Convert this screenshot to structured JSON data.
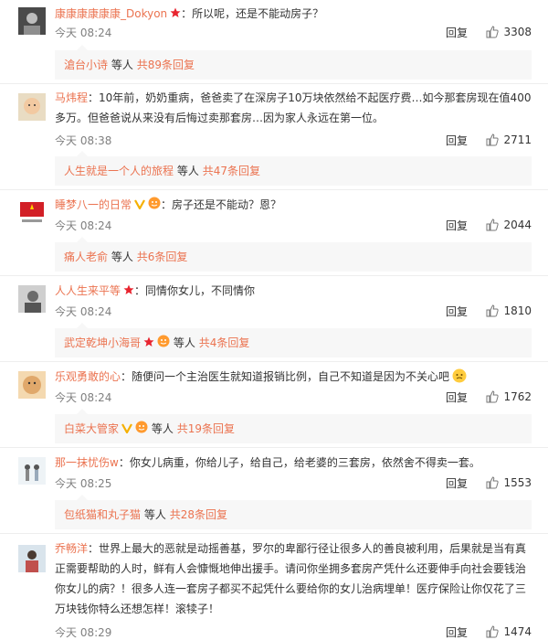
{
  "colors": {
    "accent": "#eb7350",
    "meta": "#808080",
    "sub_bg": "#f7f7f7",
    "crown": "#e8242f",
    "vip": "#f5b000"
  },
  "common": {
    "reply_label": "回复",
    "like_icon": "thumbs-up-icon",
    "etc": "等人",
    "total_prefix": "共",
    "total_suffix": "条回复"
  },
  "comments": [
    {
      "user": "康康康康康康_Dokyon",
      "text": "：所以呢，还是不能动房子？",
      "time": "今天 08:24",
      "likes": "3308",
      "sub_user": "滄台小诗",
      "sub_count": "89"
    },
    {
      "user": "马炜程",
      "text": "：10年前，奶奶重病，爸爸卖了在深房子10万块依然给不起医疗费…如今那套房现在值400多万。但爸爸说从来没有后悔过卖那套房…因为家人永远在第一位。",
      "time": "今天 08:38",
      "likes": "2711",
      "sub_user": "人生就是一个人的旅程",
      "sub_count": "47"
    },
    {
      "user": "睡梦八一的日常",
      "text": "：房子还是不能动？恩？",
      "time": "今天 08:24",
      "likes": "2044",
      "sub_user": "痛人老俞",
      "sub_count": "6"
    },
    {
      "user": "人人生来平等",
      "text": "：同情你女儿，不同情你",
      "time": "今天 08:24",
      "likes": "1810",
      "sub_user": "武定乾坤小海哥",
      "sub_count": "4"
    },
    {
      "user": "乐观勇敢的心",
      "text": "：随便问一个主治医生就知道报销比例，自己不知道是因为不关心吧",
      "time": "今天 08:24",
      "likes": "1762",
      "sub_user": "白菜大管家",
      "sub_count": "19"
    },
    {
      "user": "那一抹忧伤w",
      "text": "：你女儿病重，你给儿子，给自己，给老婆的三套房，依然舍不得卖一套。",
      "time": "今天 08:25",
      "likes": "1553",
      "sub_user": "包纸猫和丸子猫",
      "sub_count": "28"
    },
    {
      "user": "乔畅洋",
      "text": "：世界上最大的恶就是动摇善基，罗尔的卑鄙行径让很多人的善良被利用，后果就是当有真正需要帮助的人时，鲜有人会慷慨地伸出援手。请问你坐拥多套房产凭什么还要伸手向社会要钱治你女儿的病？！很多人连一套房子都买不起凭什么要给你的女儿治病埋单！医疗保险让你仅花了三万块钱你特么还想怎样！滚犊子！",
      "time": "今天 08:29",
      "likes": "1474"
    }
  ]
}
